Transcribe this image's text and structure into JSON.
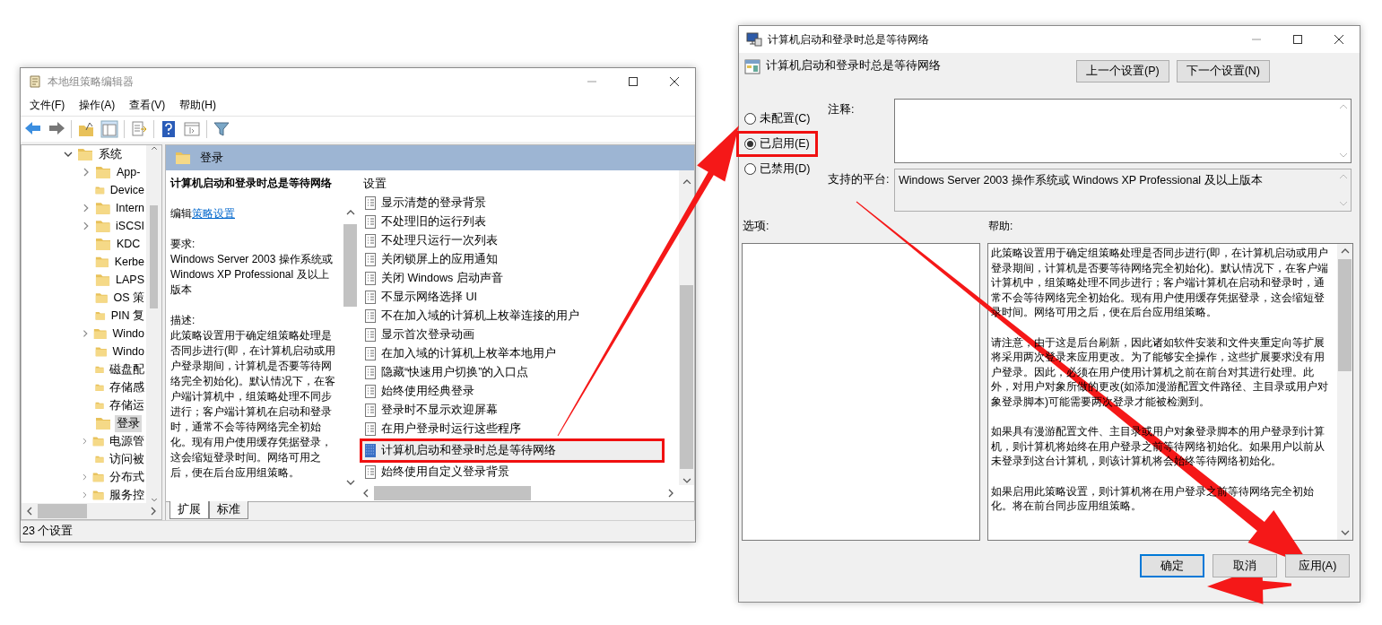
{
  "editor_window": {
    "title": "本地组策略编辑器",
    "menu": [
      "文件(F)",
      "操作(A)",
      "查看(V)",
      "帮助(H)"
    ],
    "tree": [
      {
        "label": "系统",
        "expanded": true,
        "selected": false,
        "children": [
          {
            "label": "App-",
            "expandable": true,
            "selected": false
          },
          {
            "label": "Device",
            "expandable": false,
            "selected": false
          },
          {
            "label": "Intern",
            "expandable": true,
            "selected": false
          },
          {
            "label": "iSCSI",
            "expandable": true,
            "selected": false
          },
          {
            "label": "KDC",
            "expandable": false,
            "selected": false
          },
          {
            "label": "Kerbe",
            "expandable": false,
            "selected": false
          },
          {
            "label": "LAPS",
            "expandable": false,
            "selected": false
          },
          {
            "label": "OS 策",
            "expandable": false,
            "selected": false
          },
          {
            "label": "PIN 复",
            "expandable": false,
            "selected": false
          },
          {
            "label": "Windo",
            "expandable": true,
            "selected": false
          },
          {
            "label": "Windo",
            "expandable": false,
            "selected": false
          },
          {
            "label": "磁盘配",
            "expandable": false,
            "selected": false
          },
          {
            "label": "存储感",
            "expandable": false,
            "selected": false
          },
          {
            "label": "存储运",
            "expandable": false,
            "selected": false
          },
          {
            "label": "登录",
            "expandable": false,
            "selected": true
          },
          {
            "label": "电源管",
            "expandable": true,
            "selected": false
          },
          {
            "label": "访问被",
            "expandable": false,
            "selected": false
          },
          {
            "label": "分布式",
            "expandable": true,
            "selected": false
          },
          {
            "label": "服务控",
            "expandable": true,
            "selected": false
          }
        ]
      }
    ],
    "header": "登录",
    "description": {
      "title": "计算机启动和登录时总是等待网络",
      "edit_prefix": "编辑",
      "edit_link": "策略设置",
      "requirements_label": "要求:",
      "requirements": "Windows Server 2003 操作系统或 Windows XP Professional 及以上版本",
      "description_label": "描述:",
      "description": "此策略设置用于确定组策略处理是否同步进行(即，在计算机启动或用户登录期间，计算机是否要等待网络完全初始化)。默认情况下，在客户端计算机中，组策略处理不同步进行；客户端计算机在启动和登录时，通常不会等待网络完全初始化。现有用户使用缓存凭据登录，这会缩短登录时间。网络可用之后，便在后台应用组策略。"
    },
    "settings_header": "设置",
    "settings": [
      {
        "label": "显示清楚的登录背景",
        "selected": false,
        "callout": false
      },
      {
        "label": "不处理旧的运行列表",
        "selected": false,
        "callout": false
      },
      {
        "label": "不处理只运行一次列表",
        "selected": false,
        "callout": false
      },
      {
        "label": "关闭锁屏上的应用通知",
        "selected": false,
        "callout": false
      },
      {
        "label": "关闭 Windows 启动声音",
        "selected": false,
        "callout": false
      },
      {
        "label": "不显示网络选择 UI",
        "selected": false,
        "callout": false
      },
      {
        "label": "不在加入域的计算机上枚举连接的用户",
        "selected": false,
        "callout": false
      },
      {
        "label": "显示首次登录动画",
        "selected": false,
        "callout": false
      },
      {
        "label": "在加入域的计算机上枚举本地用户",
        "selected": false,
        "callout": false
      },
      {
        "label": "隐藏“快速用户切换”的入口点",
        "selected": false,
        "callout": false
      },
      {
        "label": "始终使用经典登录",
        "selected": false,
        "callout": false
      },
      {
        "label": "登录时不显示欢迎屏幕",
        "selected": false,
        "callout": false
      },
      {
        "label": "在用户登录时运行这些程序",
        "selected": false,
        "callout": false
      },
      {
        "label": "计算机启动和登录时总是等待网络",
        "selected": true,
        "callout": true
      },
      {
        "label": "始终使用自定义登录背景",
        "selected": false,
        "callout": false
      }
    ],
    "tabs": [
      {
        "label": "扩展",
        "selected": true
      },
      {
        "label": "标准",
        "selected": false
      }
    ],
    "status_bar": "23 个设置"
  },
  "policy_dialog": {
    "title": "计算机启动和登录时总是等待网络",
    "header": "计算机启动和登录时总是等待网络",
    "nav_buttons": [
      "上一个设置(P)",
      "下一个设置(N)"
    ],
    "states": [
      {
        "label": "未配置(C)",
        "selected": false,
        "callout": false
      },
      {
        "label": "已启用(E)",
        "selected": true,
        "callout": true
      },
      {
        "label": "已禁用(D)",
        "selected": false,
        "callout": false
      }
    ],
    "comment_label": "注释:",
    "platform_label": "支持的平台:",
    "platform": "Windows Server 2003 操作系统或 Windows XP Professional 及以上版本",
    "options_label": "选项:",
    "help_label": "帮助:",
    "help": [
      "此策略设置用于确定组策略处理是否同步进行(即，在计算机启动或用户登录期间，计算机是否要等待网络完全初始化)。默认情况下，在客户端计算机中，组策略处理不同步进行；客户端计算机在启动和登录时，通常不会等待网络完全初始化。现有用户使用缓存凭据登录，这会缩短登录时间。网络可用之后，便在后台应用组策略。",
      "请注意，由于这是后台刷新，因此诸如软件安装和文件夹重定向等扩展将采用两次登录来应用更改。为了能够安全操作，这些扩展要求没有用户登录。因此，必须在用户使用计算机之前在前台对其进行处理。此外，对用户对象所做的更改(如添加漫游配置文件路径、主目录或用户对象登录脚本)可能需要两次登录才能被检测到。",
      "如果具有漫游配置文件、主目录或用户对象登录脚本的用户登录到计算机，则计算机将始终在用户登录之前等待网络初始化。如果用户以前从未登录到这台计算机，则该计算机将会始终等待网络初始化。",
      "如果启用此策略设置，则计算机将在用户登录之前等待网络完全初始化。将在前台同步应用组策略。"
    ],
    "buttons": [
      {
        "label": "确定",
        "default": true
      },
      {
        "label": "取消",
        "default": false
      },
      {
        "label": "应用(A)",
        "default": false
      }
    ]
  }
}
